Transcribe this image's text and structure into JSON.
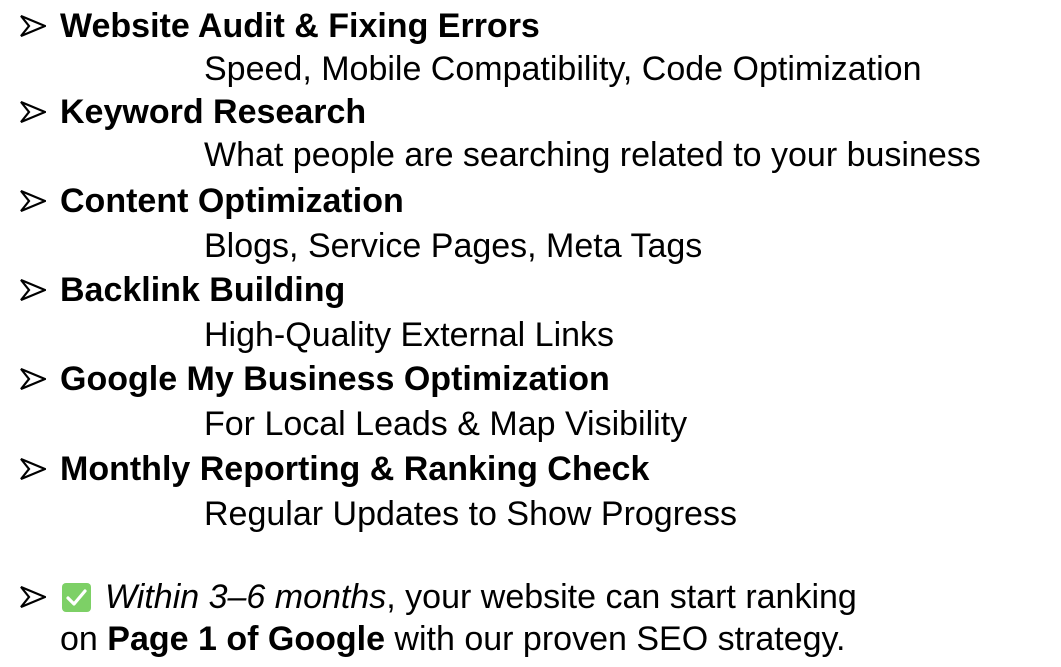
{
  "items": [
    {
      "title": "Website Audit & Fixing Errors",
      "desc": "Speed, Mobile Compatibility, Code Optimization"
    },
    {
      "title": "Keyword Research",
      "desc": "What people are searching related to your business"
    },
    {
      "title": "Content Optimization",
      "desc": "Blogs, Service Pages, Meta Tags"
    },
    {
      "title": "Backlink Building",
      "desc": "High-Quality External Links"
    },
    {
      "title": "Google My Business Optimization",
      "desc": "For Local Leads & Map Visibility"
    },
    {
      "title": "Monthly Reporting & Ranking Check",
      "desc": "Regular Updates to Show Progress"
    }
  ],
  "note": {
    "italic": "Within 3–6 months",
    "rest1": ", your website can start ranking",
    "prefix2": "on ",
    "bold": "Page 1 of Google",
    "rest2": " with our proven SEO strategy."
  },
  "colors": {
    "check_bg": "#7dd066",
    "text": "#000000"
  },
  "icons": {
    "bullet": "arrowhead-bullet-icon",
    "check": "check-box-icon"
  }
}
